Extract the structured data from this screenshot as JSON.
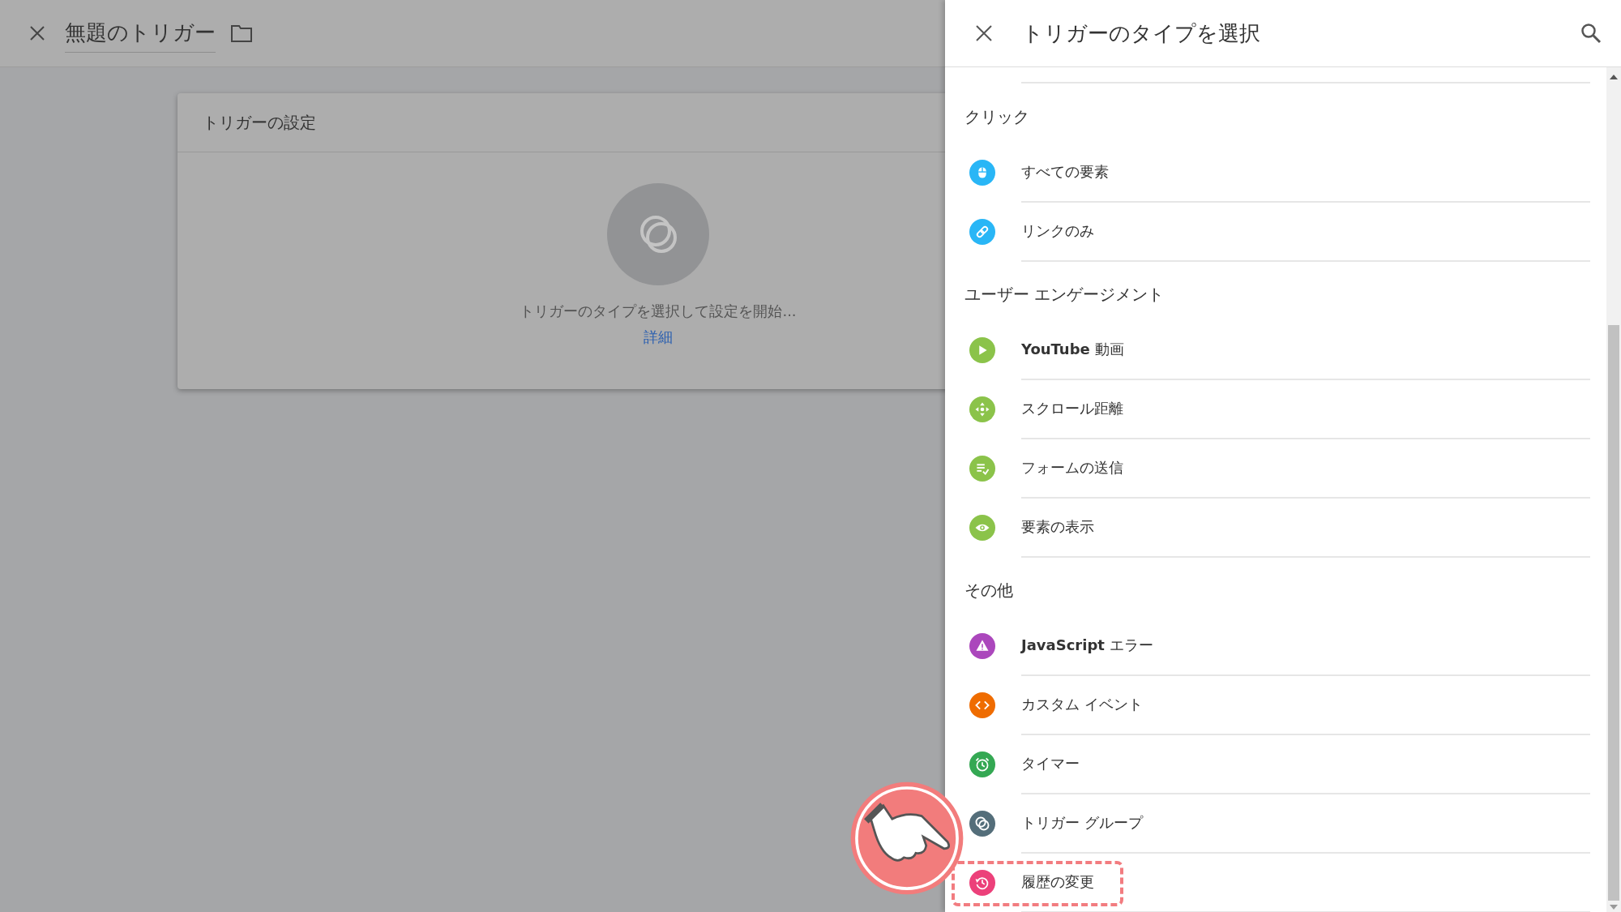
{
  "editor": {
    "title": "無題のトリガー",
    "card": {
      "title": "トリガーの設定",
      "hint": "トリガーのタイプを選択して設定を開始...",
      "link": "詳細"
    }
  },
  "panel": {
    "title": "トリガーのタイプを選択",
    "sections": [
      {
        "heading": "クリック",
        "items": [
          {
            "label": "すべての要素",
            "kind": "mouse",
            "color": "#29b6f6",
            "highlighted": false
          },
          {
            "label": "リンクのみ",
            "kind": "link",
            "color": "#29b6f6",
            "highlighted": false
          }
        ]
      },
      {
        "heading": "ユーザー エンゲージメント",
        "items": [
          {
            "label": "**YouTube** 動画",
            "kind": "play",
            "color": "#8bc34a",
            "highlighted": false
          },
          {
            "label": "スクロール距離",
            "kind": "scroll",
            "color": "#8bc34a",
            "highlighted": false
          },
          {
            "label": "フォームの送信",
            "kind": "form",
            "color": "#8bc34a",
            "highlighted": false
          },
          {
            "label": "要素の表示",
            "kind": "eye",
            "color": "#8bc34a",
            "highlighted": false
          }
        ]
      },
      {
        "heading": "その他",
        "items": [
          {
            "label": "**JavaScript** エラー",
            "kind": "warning",
            "color": "#ab47bc",
            "highlighted": false
          },
          {
            "label": "カスタム イベント",
            "kind": "code",
            "color": "#ef6c00",
            "highlighted": false
          },
          {
            "label": "タイマー",
            "kind": "timer",
            "color": "#34a853",
            "highlighted": false
          },
          {
            "label": "トリガー グループ",
            "kind": "group",
            "color": "#546e7a",
            "highlighted": false
          },
          {
            "label": "履歴の変更",
            "kind": "history",
            "color": "#ec407a",
            "highlighted": true
          }
        ]
      }
    ]
  }
}
